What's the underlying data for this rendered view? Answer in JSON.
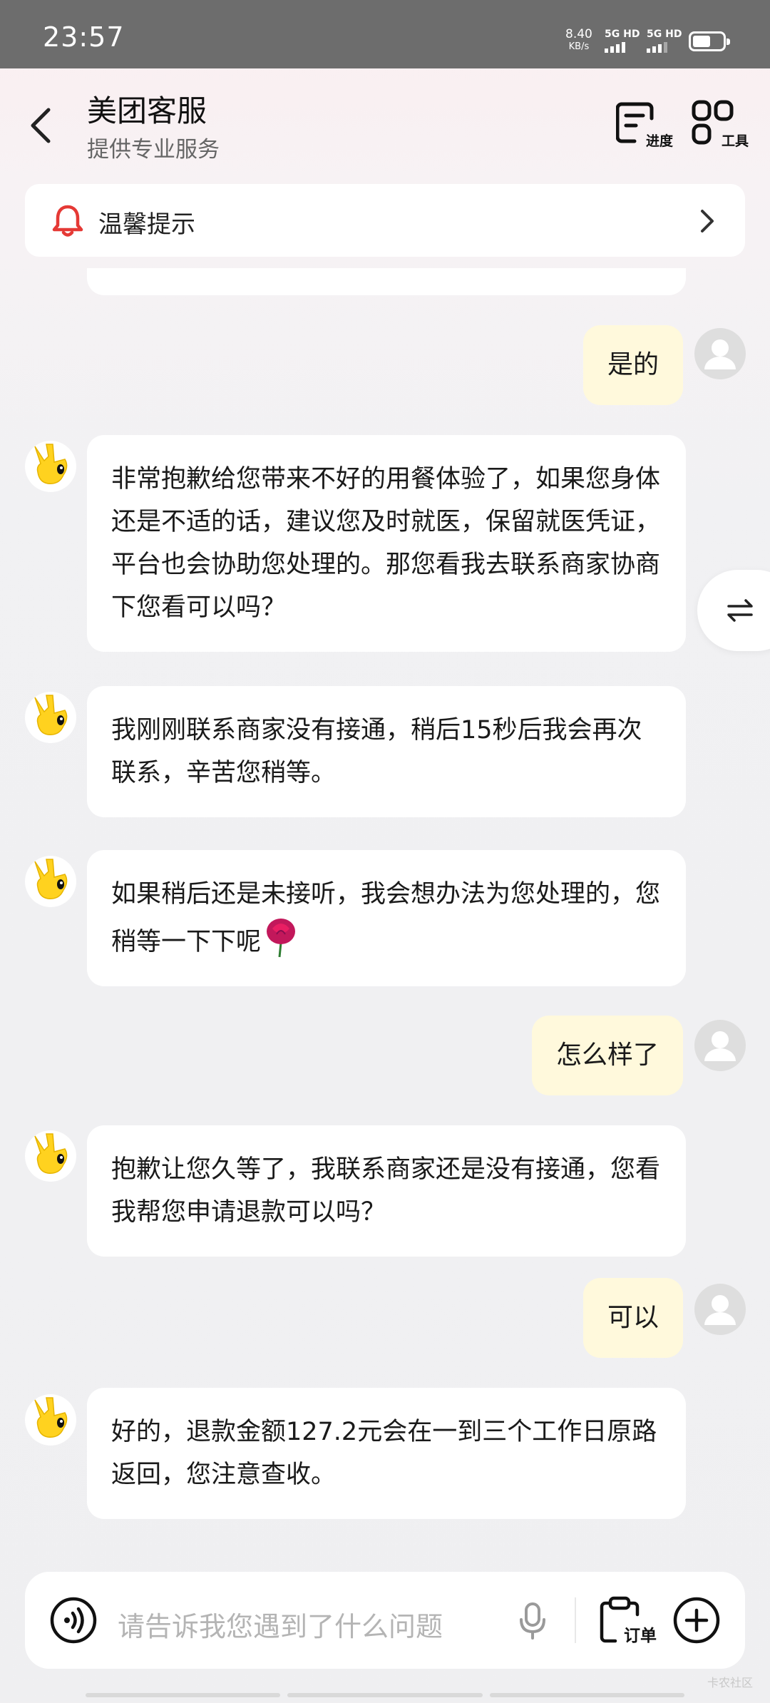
{
  "status_bar": {
    "time": "23:57",
    "net_speed": "8.40",
    "net_unit": "KB/s",
    "sim1": "5G HD",
    "sim2": "5G HD",
    "battery_level": 0.6
  },
  "header": {
    "title": "美团客服",
    "subtitle": "提供专业服务",
    "progress_label": "进度",
    "tools_label": "工具"
  },
  "notice": {
    "text": "温馨提示"
  },
  "messages": [
    {
      "sender": "user",
      "text": "是的"
    },
    {
      "sender": "bot",
      "text": "非常抱歉给您带来不好的用餐体验了，如果您身体还是不适的话，建议您及时就医，保留就医凭证，平台也会协助您处理的。那您看我去联系商家协商下您看可以吗？"
    },
    {
      "sender": "bot",
      "text": "我刚刚联系商家没有接通，稍后15秒后我会再次联系，辛苦您稍等。"
    },
    {
      "sender": "bot",
      "text": "如果稍后还是未接听，我会想办法为您处理的，您稍等一下下呢",
      "emoji": "rose"
    },
    {
      "sender": "user",
      "text": "怎么样了"
    },
    {
      "sender": "bot",
      "text": "抱歉让您久等了，我联系商家还是没有接通，您看我帮您申请退款可以吗？"
    },
    {
      "sender": "user",
      "text": "可以"
    },
    {
      "sender": "bot",
      "text": "好的，退款金额127.2元会在一到三个工作日原路返回，您注意查收。"
    }
  ],
  "input": {
    "placeholder": "请告诉我您遇到了什么问题",
    "order_label": "订单"
  },
  "watermark": "卡农社区",
  "colors": {
    "user_bubble": "#fff9dc",
    "bot_bubble": "#ffffff",
    "notice_bell": "#e53935",
    "mascot": "#ffd21f"
  }
}
